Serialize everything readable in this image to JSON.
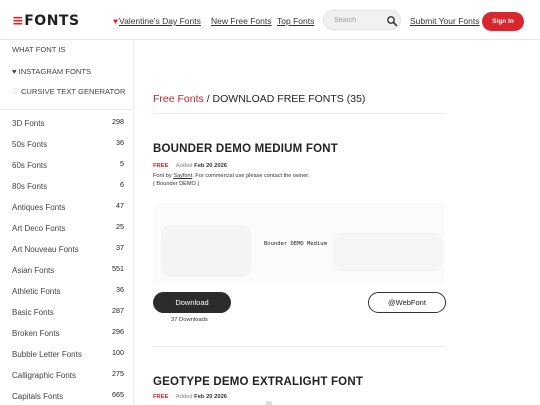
{
  "header": {
    "logo_mark": "≡",
    "logo_text": "FONTS",
    "nav": {
      "valentine_heart": "♥",
      "valentine": "Valentine's Day Fonts",
      "new_free": "New Free Fonts",
      "top": "Top Fonts",
      "submit": "Submit Your Fonts"
    },
    "search": {
      "placeholder": "Search",
      "icon": "search-icon"
    },
    "sign_in": "Sign In",
    "accent_color": "#d7262e"
  },
  "sidebar": {
    "links": [
      {
        "symbol": "",
        "label": "WHAT FONT IS"
      },
      {
        "symbol": "♥",
        "label": "INSTAGRAM FONTS"
      },
      {
        "symbol": "♡",
        "label": "CURSIVE TEXT GENERATOR"
      }
    ],
    "categories": [
      {
        "name": "3D Fonts",
        "count": "298"
      },
      {
        "name": "50s Fonts",
        "count": "36"
      },
      {
        "name": "60s Fonts",
        "count": "5"
      },
      {
        "name": "80s Fonts",
        "count": "6"
      },
      {
        "name": "Antiques Fonts",
        "count": "47"
      },
      {
        "name": "Art Deco Fonts",
        "count": "25"
      },
      {
        "name": "Art Nouveau Fonts",
        "count": "37"
      },
      {
        "name": "Asian Fonts",
        "count": "551"
      },
      {
        "name": "Athletic Fonts",
        "count": "36"
      },
      {
        "name": "Basic Fonts",
        "count": "287"
      },
      {
        "name": "Broken Fonts",
        "count": "296"
      },
      {
        "name": "Bubble Letter Fonts",
        "count": "100"
      },
      {
        "name": "Calligraphic Fonts",
        "count": "275"
      },
      {
        "name": "Capitals Fonts",
        "count": "665"
      }
    ]
  },
  "main": {
    "breadcrumb": {
      "link": "Free Fonts",
      "separator": " / ",
      "current": "DOWNLOAD FREE FONTS",
      "count": "(35)"
    },
    "fonts": [
      {
        "title": "BOUNDER DEMO MEDIUM FONT",
        "badge": "FREE",
        "added_label": "Added",
        "date": "Feb 20 2026",
        "by_prefix": "Font by ",
        "author": "Sayfont",
        "by_suffix": ". For commercial use please contact the owner.",
        "family_note": "( Bounder DEMO )",
        "preview_text": "Bounder DEMO Medium",
        "download_label": "Download",
        "downloads": "37 Downloads",
        "webfont_label": "@WebFont"
      },
      {
        "title": "GEOTYPE DEMO EXTRALIGHT FONT",
        "badge": "FREE",
        "added_label": "Added",
        "date": "Feb 20 2026"
      }
    ]
  }
}
